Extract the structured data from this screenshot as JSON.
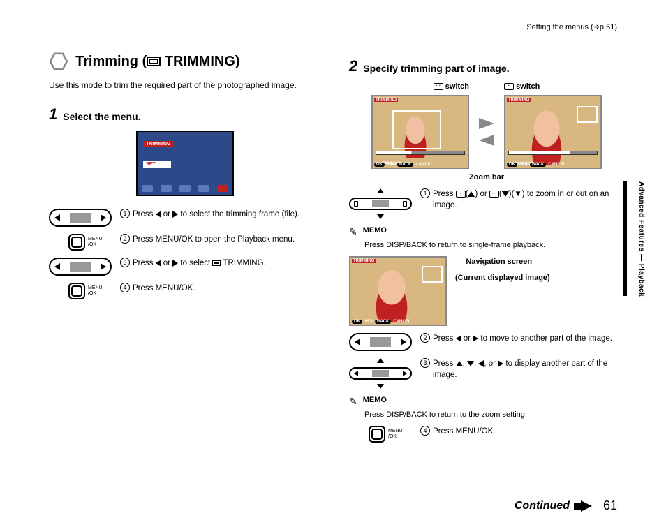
{
  "header_ref": "Setting the menus (➔p.51)",
  "section_title_pre": "Trimming (",
  "section_title_post": " TRIMMING)",
  "intro": "Use this mode to trim the required part of the photographed image.",
  "step1_title": "Select the menu.",
  "step1_num": "1",
  "lcd": {
    "trimming": "TRIMMING",
    "set": "SET"
  },
  "left": {
    "i1": "Press ◀ or ▶ to select the trimming frame (file).",
    "i2": "Press MENU/OK to open the Playback menu.",
    "i3": "Press ◀ or ▶ to select ⬚ TRIMMING.",
    "i4": "Press MENU/OK."
  },
  "ok_label": "MENU\n/OK",
  "step2_num": "2",
  "step2_title": "Specify trimming part of image.",
  "switch_out": "switch",
  "switch_in": "switch",
  "photo": {
    "trimming": "TRIMMING",
    "panning": "PANNING",
    "ok": "OK",
    "yes": "YES",
    "back": "BACK",
    "cancel": "CANCEL"
  },
  "zoom_bar_label": "Zoom bar",
  "right": {
    "i1_a": "Press ",
    "i1_b": "(▲) or ",
    "i1_c": "(▼) to zoom in or out on an image.",
    "memo1_title": "MEMO",
    "memo1": "Press DISP/BACK to return to single-frame playback.",
    "nav_caption1": "Navigation screen",
    "nav_caption2": "(Current displayed image)",
    "i2": "Press ◀ or ▶ to move to another part of the image.",
    "i3": "Press ▲, ▼, ◀, or ▶ to display another part of the image.",
    "memo2_title": "MEMO",
    "memo2": "Press DISP/BACK to return to the zoom setting.",
    "i4": "Press MENU/OK."
  },
  "side_tab": "Advanced Features — Playback",
  "continued": "Continued",
  "page_num": "61"
}
